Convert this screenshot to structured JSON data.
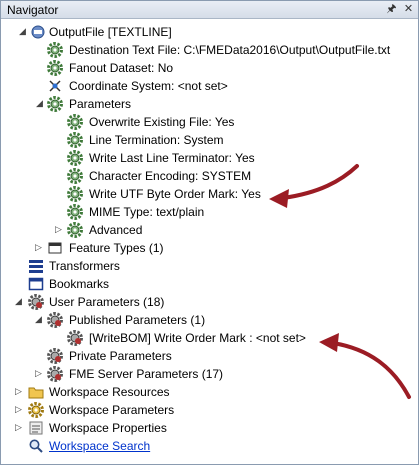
{
  "panel": {
    "title": "Navigator",
    "pin_glyph": "🖈",
    "close_glyph": "✕"
  },
  "tree": {
    "output_file": "OutputFile [TEXTLINE]",
    "destination": "Destination Text File: C:\\FMEData2016\\Output\\OutputFile.txt",
    "fanout": "Fanout Dataset: No",
    "coord": "Coordinate System: <not set>",
    "parameters": "Parameters",
    "p_overwrite": "Overwrite Existing File: Yes",
    "p_line_term": "Line Termination: System",
    "p_last_line": "Write Last Line Terminator: Yes",
    "p_encoding": "Character Encoding: SYSTEM",
    "p_bom": "Write UTF Byte Order Mark: Yes",
    "p_mime": "MIME Type: text/plain",
    "p_advanced": "Advanced",
    "feature_types": "Feature Types (1)",
    "transformers": "Transformers",
    "bookmarks": "Bookmarks",
    "user_params": "User Parameters (18)",
    "published": "Published Parameters (1)",
    "writebom": "[WriteBOM] Write Order Mark : <not set>",
    "private": "Private Parameters",
    "fme_server": "FME Server Parameters (17)",
    "ws_resources": "Workspace Resources",
    "ws_params": "Workspace Parameters",
    "ws_props": "Workspace Properties",
    "ws_search": "Workspace Search"
  },
  "colors": {
    "annotation_arrow": "#9b1c24",
    "gear": "#3f7a3a",
    "link": "#0033cc"
  }
}
